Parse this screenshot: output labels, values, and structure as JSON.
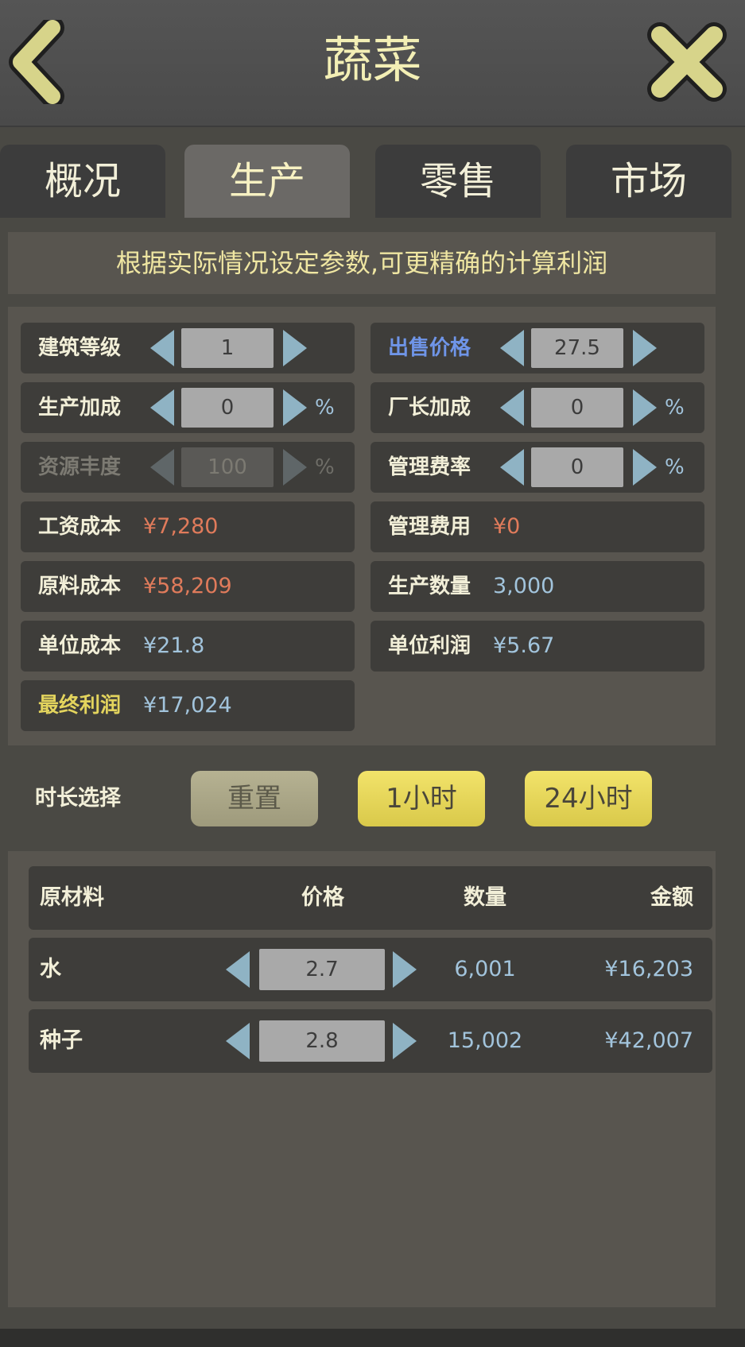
{
  "header": {
    "title": "蔬菜",
    "back_icon": "chevron-left-icon",
    "close_icon": "close-icon"
  },
  "tabs": [
    {
      "label": "概况",
      "active": false
    },
    {
      "label": "生产",
      "active": true
    },
    {
      "label": "零售",
      "active": false
    },
    {
      "label": "市场",
      "active": false
    }
  ],
  "hint": "根据实际情况设定参数,可更精确的计算利润",
  "params": {
    "building_level": {
      "label": "建筑等级",
      "value": "1"
    },
    "sell_price": {
      "label": "出售价格",
      "value": "27.5"
    },
    "production_bonus": {
      "label": "生产加成",
      "value": "0",
      "unit": "%"
    },
    "manager_bonus": {
      "label": "厂长加成",
      "value": "0",
      "unit": "%"
    },
    "resource_abundance": {
      "label": "资源丰度",
      "value": "100",
      "unit": "%"
    },
    "management_rate": {
      "label": "管理费率",
      "value": "0",
      "unit": "%"
    },
    "wage_cost": {
      "label": "工资成本",
      "value": "¥7,280"
    },
    "management_fee": {
      "label": "管理费用",
      "value": "¥0"
    },
    "material_cost": {
      "label": "原料成本",
      "value": "¥58,209"
    },
    "production_qty": {
      "label": "生产数量",
      "value": "3,000"
    },
    "unit_cost": {
      "label": "单位成本",
      "value": "¥21.8"
    },
    "unit_profit": {
      "label": "单位利润",
      "value": "¥5.67"
    },
    "final_profit": {
      "label": "最终利润",
      "value": "¥17,024"
    }
  },
  "duration": {
    "label": "时长选择",
    "reset": "重置",
    "one_hour": "1小时",
    "day": "24小时"
  },
  "materials": {
    "headers": {
      "name": "原材料",
      "price": "价格",
      "qty": "数量",
      "amount": "金额"
    },
    "rows": [
      {
        "name": "水",
        "price": "2.7",
        "qty": "6,001",
        "amount": "¥16,203"
      },
      {
        "name": "种子",
        "price": "2.8",
        "qty": "15,002",
        "amount": "¥42,007"
      }
    ]
  },
  "colors": {
    "arrow": "#8fb3c4",
    "highlight_yellow": "#e3d45d",
    "cost_red": "#e07b5b",
    "value_cyan": "#a2c4dc",
    "sell_blue": "#6f95e8"
  }
}
